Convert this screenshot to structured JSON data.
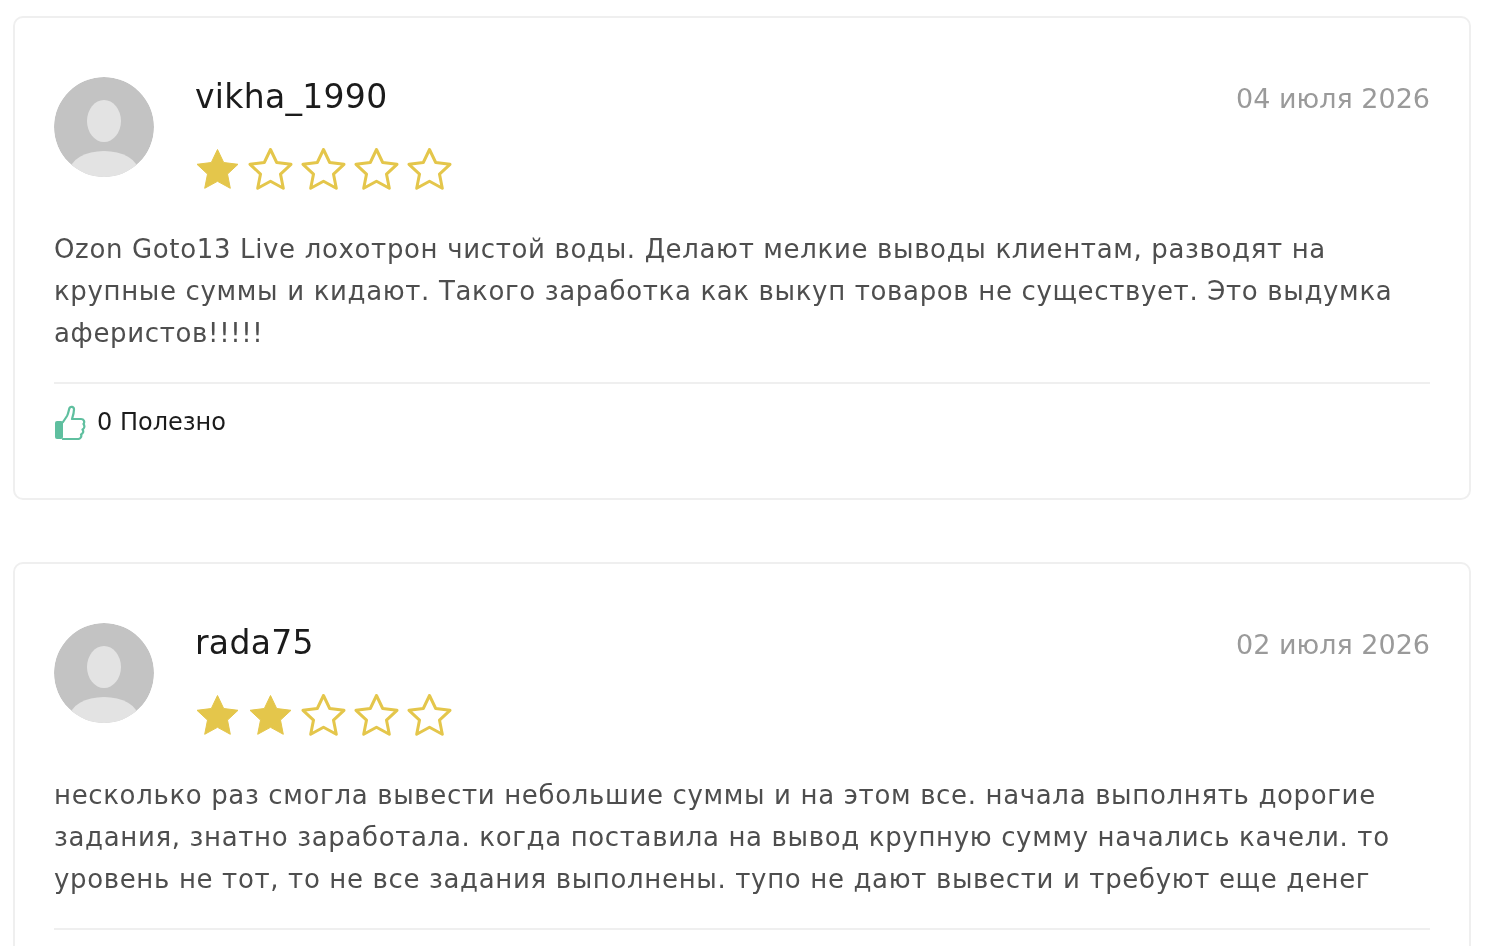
{
  "reviews": [
    {
      "author": "vikha_1990",
      "date": "04 июля 2026",
      "stars": 1,
      "text": "Ozon Goto13 Live лохотрон чистой воды. Делают мелкие выводы клиентам, разводят на крупные суммы и кидают. Такого заработка как выкуп товаров не существует. Это выдумка аферистов!!!!!",
      "helpful": {
        "count": "0",
        "label": "Полезно"
      }
    },
    {
      "author": "rada75",
      "date": "02 июля 2026",
      "stars": 2,
      "text": "несколько раз смогла вывести небольшие суммы и на этом все. начала выполнять дорогие задания, знатно заработала. когда поставила на вывод крупную сумму начались качели. то уровень не тот, то не все задания выполнены. тупо не дают вывести и требуют еще денег"
    }
  ]
}
